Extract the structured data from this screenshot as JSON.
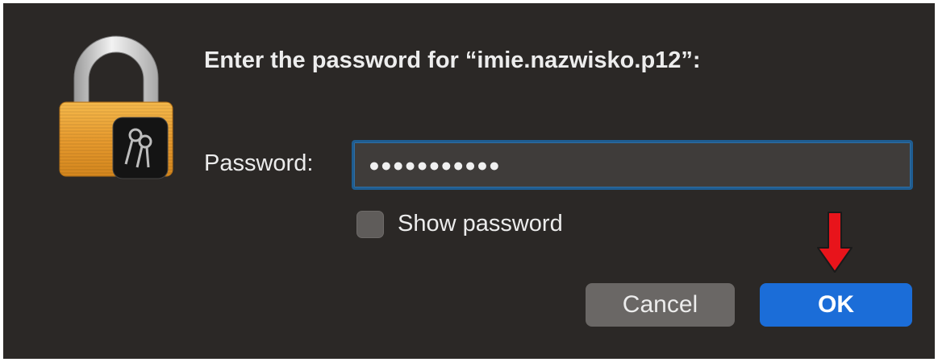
{
  "dialog": {
    "title": "Enter the password for “imie.nazwisko.p12”:",
    "icon": "keychain-lock-icon"
  },
  "password": {
    "label": "Password:",
    "masked_value": "●●●●●●●●●●●"
  },
  "show_password": {
    "label": "Show password",
    "checked": false
  },
  "buttons": {
    "cancel_label": "Cancel",
    "ok_label": "OK"
  },
  "annotation": {
    "icon": "red-arrow-down-icon",
    "color": "#e8141b"
  },
  "colors": {
    "background": "#2b2826",
    "accent": "#1b6dd8",
    "focus_ring": "#1f5d91",
    "lock_gold": "#e8a23a"
  }
}
